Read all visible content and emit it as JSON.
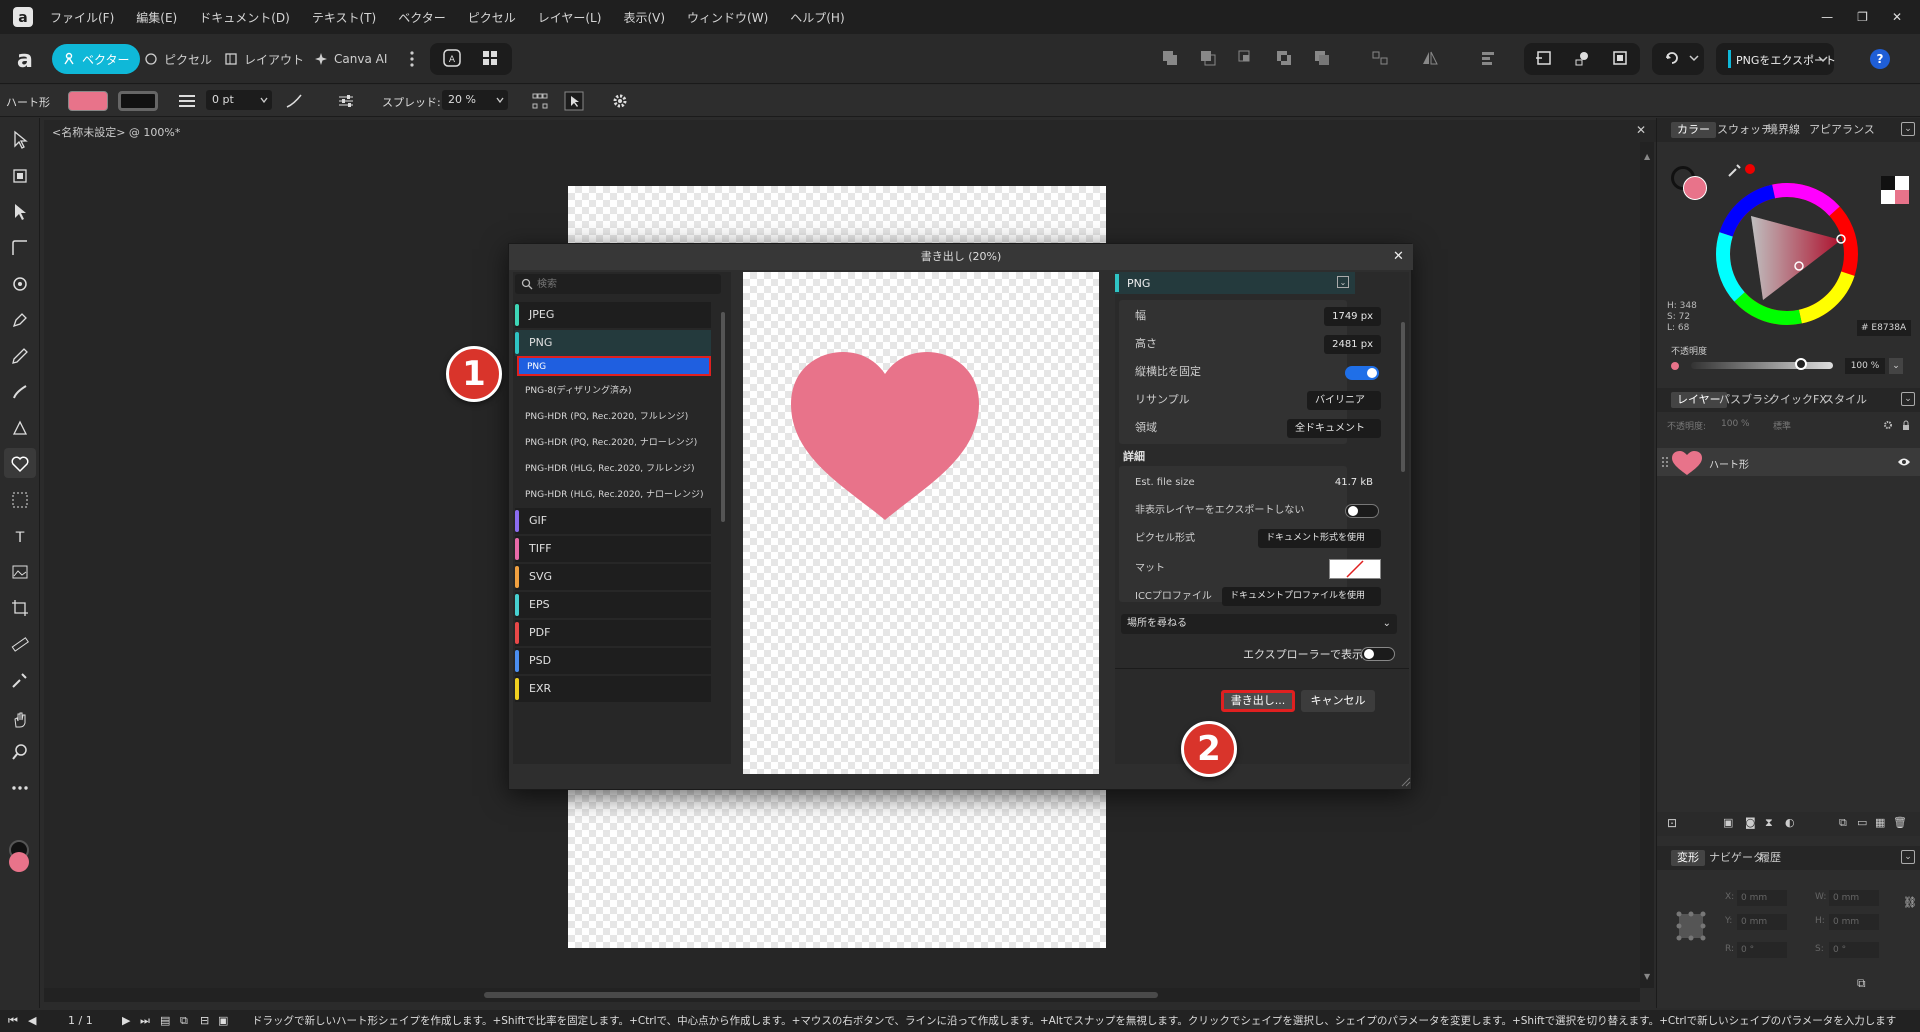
{
  "menu": [
    "ファイル(F)",
    "編集(E)",
    "ドキュメント(D)",
    "テキスト(T)",
    "ベクター",
    "ピクセル",
    "レイヤー(L)",
    "表示(V)",
    "ウィンドウ(W)",
    "ヘルプ(H)"
  ],
  "window_controls": [
    "—",
    "❐",
    "✕"
  ],
  "personas": {
    "vector": "ベクター",
    "pixel": "ピクセル",
    "layout": "レイアウト",
    "canva": "Canva AI"
  },
  "toolbar": {
    "export_label": "PNGをエクスポート",
    "help": "?"
  },
  "context": {
    "shape_name": "ハート形",
    "stroke_width": "0 pt",
    "spread_label": "スプレッド:",
    "spread_value": "20 %"
  },
  "document": {
    "tab_title": "<名称未設定> @ 100%*"
  },
  "dialog": {
    "title": "書き出し (20%)",
    "search_placeholder": "検索",
    "formats": [
      {
        "label": "JPEG",
        "color": "#3ed6b6"
      },
      {
        "label": "PNG",
        "color": "#2fc4c4"
      },
      {
        "label": "GIF",
        "color": "#8b6cf0"
      },
      {
        "label": "TIFF",
        "color": "#e86aa8"
      },
      {
        "label": "SVG",
        "color": "#f0a040"
      },
      {
        "label": "EPS",
        "color": "#47d0d0"
      },
      {
        "label": "PDF",
        "color": "#e84848"
      },
      {
        "label": "PSD",
        "color": "#4b8ef0"
      },
      {
        "label": "EXR",
        "color": "#f0d020"
      }
    ],
    "png_presets": [
      "PNG",
      "PNG-8(ディザリング済み)",
      "PNG-HDR (PQ, Rec.2020, フルレンジ)",
      "PNG-HDR (PQ, Rec.2020, ナローレンジ)",
      "PNG-HDR (HLG, Rec.2020, フルレンジ)",
      "PNG-HDR (HLG, Rec.2020, ナローレンジ)"
    ],
    "settings_header": "PNG",
    "width_label": "幅",
    "width_value": "1749 px",
    "height_label": "高さ",
    "height_value": "2481 px",
    "lock_ratio_label": "縦横比を固定",
    "resample_label": "リサンプル",
    "resample_value": "バイリニア",
    "area_label": "領域",
    "area_value": "全ドキュメント",
    "details_label": "詳細",
    "filesize_label": "Est. file size",
    "filesize_value": "41.7 kB",
    "hidden_layers_label": "非表示レイヤーをエクスポートしない",
    "pixel_format_label": "ピクセル形式",
    "pixel_format_value": "ドキュメント形式を使用",
    "matte_label": "マット",
    "icc_label": "ICCプロファイル",
    "icc_value": "ドキュメントプロファイルを使用",
    "location_label": "場所を尋ねる",
    "explorer_label": "エクスプローラーで表示",
    "export_button": "書き出し...",
    "cancel_button": "キャンセル"
  },
  "annotations": {
    "step1": "1",
    "step2": "2"
  },
  "color_panel": {
    "tabs": [
      "カラー",
      "スウォッチ",
      "境界線",
      "アピアランス"
    ],
    "h": "H: 348",
    "s": "S: 72",
    "l": "L: 68",
    "hex": "E8738A",
    "opacity_label": "不透明度",
    "opacity_value": "100 %",
    "fill_color": "#e8738a"
  },
  "layers_panel": {
    "tabs": [
      "レイヤー",
      "パスブラシ",
      "クイックFX",
      "スタイル"
    ],
    "opacity_label": "不透明度:",
    "opacity_value": "100 %",
    "blend": "標準",
    "layer_name": "ハート形"
  },
  "transform_panel": {
    "tabs": [
      "変形",
      "ナビゲータ",
      "履歴"
    ],
    "x": "0 mm",
    "y": "0 mm",
    "w": "0 mm",
    "h": "0 mm",
    "r": "0 °",
    "s": "0 °"
  },
  "status": {
    "page": "1 / 1",
    "hint": "ドラッグで新しいハート形シェイプを作成します。+Shiftで比率を固定します。+Ctrlで、中心点から作成します。+マウスの右ボタンで、ラインに沿って作成します。+Altでスナップを無視します。クリックでシェイプを選択し、シェイプのパラメータを変更します。+Shiftで選択を切り替えます。+Ctrlで新しいシェイプのパラメータを入力します"
  }
}
